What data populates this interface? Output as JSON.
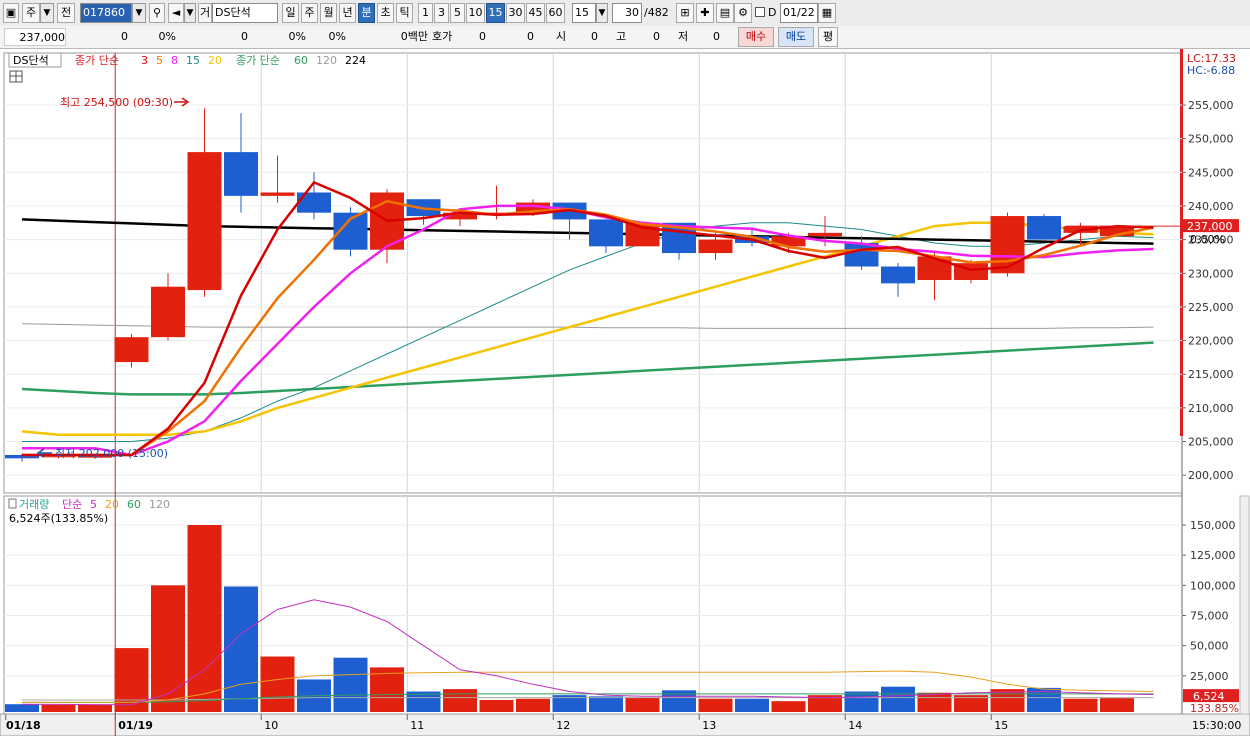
{
  "toolbar": {
    "market": "주",
    "prev_btn": "전",
    "code": "017860",
    "vol_btn": "거",
    "indicator": "DS단석",
    "periods": [
      "일",
      "주",
      "월",
      "년",
      "분",
      "초",
      "틱"
    ],
    "active_period": "분",
    "minutes": [
      "1",
      "3",
      "5",
      "10",
      "15",
      "30",
      "45",
      "60"
    ],
    "active_minute": "15",
    "interval_value": "15",
    "count": "30",
    "total": "/482",
    "checkbox_label": "D",
    "date": "01/22"
  },
  "quote_bar": {
    "price": "237,000",
    "change": "0",
    "change_pct": "0%",
    "volume": "0",
    "volume_pct": "0%",
    "amount": "0",
    "amount_pct": "0%",
    "amount_unit": "0백만",
    "bid_label": "호가",
    "bid_values": [
      "0",
      "0"
    ],
    "open_label": "시",
    "open": "0",
    "high_label": "고",
    "high": "0",
    "low_label": "저",
    "low": "0",
    "buy": "매수",
    "sell": "매도",
    "avg": "평"
  },
  "colors": {
    "up": "#e3210f",
    "down": "#1d5fd1",
    "ma3": "#d90000",
    "ma5": "#f07000",
    "ma8": "#f020f0",
    "ma15": "#1a8a8a",
    "ma20": "#f5c400",
    "ma60": "#2e9e5e",
    "ma120": "#9a9a9a",
    "ma224": "#000000"
  },
  "price_panel": {
    "tag": "DS단석",
    "legend_prefix": "종가 단순",
    "legend_periods": [
      "3",
      "5",
      "8",
      "15",
      "20"
    ],
    "legend2_prefix": "종가 단순",
    "legend2_periods": [
      "60",
      "120",
      "224"
    ],
    "high_note": "최고 254,500 (09:30)",
    "low_note": "최저 202,000 (15:00)",
    "lc": "LC:17.33",
    "hc": "HC:-6.88",
    "current_price_tag": "237,000",
    "current_pct_tag": "0.00%",
    "y_ticks": [
      "255,000",
      "250,000",
      "245,000",
      "240,000",
      "235,000",
      "230,000",
      "225,000",
      "220,000",
      "215,000",
      "210,000",
      "205,000",
      "200,000"
    ]
  },
  "volume_panel": {
    "legend_prefix": "거래량",
    "ma_prefix": "단순",
    "ma_periods": [
      "5",
      "20",
      "60",
      "120"
    ],
    "info": "6,524주(133.85%)",
    "y_ticks": [
      "150,000",
      "125,000",
      "100,000",
      "75,000",
      "50,000",
      "25,000"
    ],
    "current_tag": "6,524",
    "current_pct_tag": "133.85%"
  },
  "x_axis": {
    "labels": [
      "01/18",
      "01/19",
      "10",
      "11",
      "12",
      "13",
      "14",
      "15"
    ],
    "time": "15:30:00"
  },
  "chart_data": {
    "type": "candlestick",
    "candles": [
      {
        "o": 203.0,
        "h": 203.2,
        "l": 202.0,
        "c": 202.5,
        "v": 1500
      },
      {
        "o": 202.8,
        "h": 203.0,
        "l": 202.5,
        "c": 202.8,
        "v": 1000
      },
      {
        "o": 202.6,
        "h": 203.0,
        "l": 202.4,
        "c": 202.9,
        "v": 1200
      },
      {
        "o": 216.8,
        "h": 221.0,
        "l": 216.0,
        "c": 220.5,
        "v": 48000
      },
      {
        "o": 220.5,
        "h": 230.0,
        "l": 220.0,
        "c": 228.0,
        "v": 100000
      },
      {
        "o": 227.5,
        "h": 254.5,
        "l": 226.5,
        "c": 248.0,
        "v": 150000
      },
      {
        "o": 248.0,
        "h": 253.8,
        "l": 239.0,
        "c": 241.5,
        "v": 99000
      },
      {
        "o": 241.5,
        "h": 247.5,
        "l": 240.5,
        "c": 242.0,
        "v": 41000
      },
      {
        "o": 242.0,
        "h": 245.0,
        "l": 238.0,
        "c": 239.0,
        "v": 22000
      },
      {
        "o": 239.0,
        "h": 239.8,
        "l": 232.5,
        "c": 233.5,
        "v": 40000
      },
      {
        "o": 233.5,
        "h": 242.5,
        "l": 231.5,
        "c": 242.0,
        "v": 32000
      },
      {
        "o": 241.0,
        "h": 241.0,
        "l": 237.2,
        "c": 238.5,
        "v": 12000
      },
      {
        "o": 238.0,
        "h": 239.5,
        "l": 237.0,
        "c": 239.0,
        "v": 14000
      },
      {
        "o": 239.0,
        "h": 243.0,
        "l": 238.0,
        "c": 239.0,
        "v": 5000
      },
      {
        "o": 239.0,
        "h": 241.0,
        "l": 238.5,
        "c": 240.5,
        "v": 6000
      },
      {
        "o": 240.5,
        "h": 240.5,
        "l": 235.0,
        "c": 238.0,
        "v": 9000
      },
      {
        "o": 238.0,
        "h": 238.0,
        "l": 233.0,
        "c": 234.0,
        "v": 8000
      },
      {
        "o": 234.0,
        "h": 237.5,
        "l": 234.0,
        "c": 237.5,
        "v": 7000
      },
      {
        "o": 237.5,
        "h": 237.5,
        "l": 232.0,
        "c": 233.0,
        "v": 13000
      },
      {
        "o": 233.0,
        "h": 236.0,
        "l": 232.0,
        "c": 235.0,
        "v": 6000
      },
      {
        "o": 235.5,
        "h": 236.5,
        "l": 234.0,
        "c": 234.5,
        "v": 6000
      },
      {
        "o": 234.0,
        "h": 236.0,
        "l": 233.0,
        "c": 235.5,
        "v": 4000
      },
      {
        "o": 235.5,
        "h": 238.5,
        "l": 234.0,
        "c": 236.0,
        "v": 9000
      },
      {
        "o": 234.5,
        "h": 235.5,
        "l": 230.5,
        "c": 231.0,
        "v": 12000
      },
      {
        "o": 231.0,
        "h": 231.5,
        "l": 226.5,
        "c": 228.5,
        "v": 16000
      },
      {
        "o": 229.0,
        "h": 233.0,
        "l": 226.0,
        "c": 232.5,
        "v": 11000
      },
      {
        "o": 229.0,
        "h": 232.0,
        "l": 228.5,
        "c": 231.5,
        "v": 9000
      },
      {
        "o": 230.0,
        "h": 239.0,
        "l": 229.5,
        "c": 238.5,
        "v": 14000
      },
      {
        "o": 238.5,
        "h": 238.8,
        "l": 235.0,
        "c": 235.0,
        "v": 15000
      },
      {
        "o": 236.0,
        "h": 237.5,
        "l": 234.0,
        "c": 237.0,
        "v": 6000
      },
      {
        "o": 235.5,
        "h": 237.0,
        "l": 235.5,
        "c": 237.0,
        "v": 6524
      }
    ],
    "ma": {
      "ma3": [
        203,
        203,
        203,
        203,
        206.9,
        213.7,
        226.7,
        236.5,
        243.5,
        241.2,
        237.8,
        238.2,
        239.0,
        238.7,
        238.8,
        239.4,
        238.5,
        236.8,
        236.2,
        235.6,
        235.0,
        233.3,
        232.3,
        233.5,
        233.9,
        232.2,
        230.5,
        230.9,
        233.8,
        236.4,
        237.0,
        236.8
      ],
      "ma5": [
        203,
        203,
        203,
        203,
        206.5,
        211.0,
        219.0,
        226.3,
        232.0,
        238.1,
        240.7,
        239.6,
        239.3,
        238.7,
        239.2,
        239.5,
        238.7,
        237.3,
        236.8,
        236.2,
        235.4,
        233.9,
        233.2,
        233.5,
        233.3,
        232.5,
        231.6,
        231.8,
        232.7,
        234.1,
        235.7,
        236.8
      ],
      "ma8": [
        204,
        204,
        204,
        203,
        205.0,
        208.0,
        214.0,
        219.5,
        225.0,
        230.0,
        234.0,
        236.5,
        239.5,
        240.0,
        240.0,
        239.5,
        238.3,
        237.5,
        237.0,
        236.8,
        236.6,
        235.6,
        234.8,
        234.4,
        233.6,
        233.2,
        232.6,
        232.5,
        232.4,
        233.0,
        233.4,
        233.6
      ],
      "ma15": [
        205,
        205,
        205,
        205,
        205.5,
        206.5,
        208.5,
        211.0,
        213.0,
        215.5,
        218.0,
        220.5,
        223.0,
        225.5,
        228.0,
        230.5,
        232.5,
        234.5,
        236.0,
        237.0,
        237.5,
        237.5,
        237.0,
        236.5,
        235.5,
        234.5,
        234.0,
        234.0,
        234.5,
        235.0,
        235.5,
        235.3
      ],
      "ma20": [
        206.5,
        206.0,
        206.0,
        206.0,
        206.0,
        206.5,
        208.0,
        210.0,
        211.5,
        213.0,
        214.5,
        216.0,
        217.5,
        219.0,
        220.5,
        222.0,
        223.5,
        225.0,
        226.5,
        228.0,
        229.5,
        231.0,
        232.5,
        234.0,
        235.5,
        237.0,
        237.5,
        237.5,
        237.0,
        236.5,
        236.0,
        235.8
      ],
      "ma60": [
        212.8,
        212.5,
        212.2,
        212.0,
        212.0,
        212.0,
        212.2,
        212.5,
        212.8,
        213.1,
        213.4,
        213.7,
        214.0,
        214.3,
        214.6,
        214.9,
        215.2,
        215.5,
        215.8,
        216.1,
        216.4,
        216.7,
        217.0,
        217.3,
        217.6,
        217.9,
        218.2,
        218.5,
        218.8,
        219.1,
        219.4,
        219.7
      ],
      "ma120": [
        222.5,
        222.4,
        222.3,
        222.2,
        222.1,
        222.0,
        222.0,
        222.0,
        222.0,
        222.0,
        222.0,
        222.0,
        222.0,
        222.0,
        222.0,
        222.0,
        221.9,
        221.9,
        221.9,
        221.8,
        221.8,
        221.8,
        221.8,
        221.8,
        221.8,
        221.8,
        221.8,
        221.8,
        221.8,
        221.9,
        221.9,
        222.0
      ],
      "ma224": [
        238.0,
        237.8,
        237.6,
        237.4,
        237.2,
        237.0,
        236.9,
        236.8,
        236.7,
        236.6,
        236.5,
        236.4,
        236.3,
        236.2,
        236.1,
        236.0,
        235.9,
        235.8,
        235.7,
        235.6,
        235.5,
        235.4,
        235.3,
        235.2,
        235.1,
        235.0,
        234.9,
        234.8,
        234.7,
        234.6,
        234.5,
        234.4
      ]
    },
    "vol_ma5": [
      1500,
      1300,
      1200,
      1100,
      10000,
      30000,
      60000,
      80000,
      88000,
      82000,
      70000,
      50000,
      30000,
      25000,
      18000,
      12000,
      9000,
      8000,
      8000,
      8000,
      8000,
      7500,
      7000,
      7500,
      8500,
      9500,
      11000,
      11500,
      12000,
      11000,
      10000,
      9500
    ],
    "vol_ma20": [
      3000,
      3000,
      3000,
      3000,
      5000,
      10000,
      18000,
      22000,
      25000,
      26000,
      27000,
      27500,
      28000,
      28000,
      28000,
      28000,
      28000,
      28000,
      28000,
      28000,
      28000,
      28000,
      28000,
      28500,
      29000,
      28000,
      24000,
      18000,
      14000,
      13000,
      12500,
      12000
    ],
    "vol_ma60": [
      3000,
      3000,
      3000,
      3000,
      3500,
      4500,
      6000,
      7500,
      8500,
      9000,
      9500,
      9800,
      10000,
      10000,
      10000,
      10000,
      10000,
      10000,
      10000,
      10000,
      10000,
      10000,
      10000,
      10000,
      10000,
      10000,
      10000,
      10000,
      10000,
      10000,
      10000,
      10000
    ],
    "vol_ma120": [
      5000,
      5000,
      5000,
      5000,
      5000,
      5500,
      6000,
      6500,
      7000,
      7000,
      7000,
      7000,
      7000,
      7000,
      7000,
      7000,
      7000,
      7000,
      7000,
      7000,
      7000,
      7000,
      7000,
      7000,
      7000,
      7000,
      7000,
      7000,
      7000,
      7000,
      7000,
      7000
    ]
  }
}
